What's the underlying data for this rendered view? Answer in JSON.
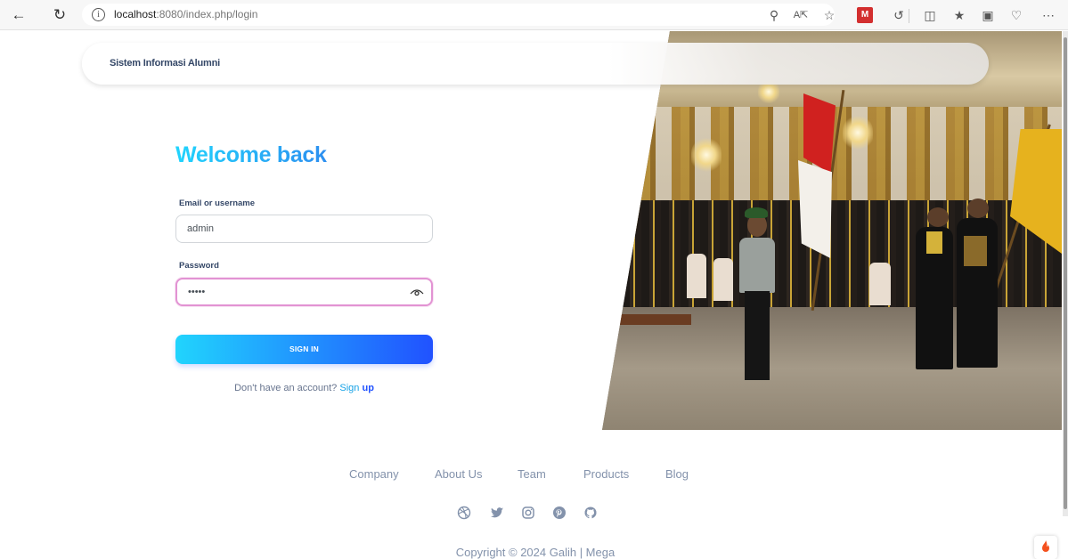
{
  "browser": {
    "url_host": "localhost",
    "url_rest": ":8080/index.php/login"
  },
  "navbar": {
    "brand": "Sistem Informasi Alumni"
  },
  "login": {
    "title": "Welcome back",
    "email_label": "Email or username",
    "email_value": "admin",
    "password_label": "Password",
    "password_value": "•••••",
    "signin_label": "SIGN IN",
    "signup_prompt": "Don't have an account?",
    "signup_link_prefix": "Sign",
    "signup_link_bold": "up"
  },
  "footer": {
    "links": [
      "Company",
      "About Us",
      "Team",
      "Products",
      "Blog"
    ],
    "social_icons": [
      "dribbble-icon",
      "twitter-icon",
      "instagram-icon",
      "pinterest-icon",
      "github-icon"
    ],
    "copyright": "Copyright © 2024 Galih | Mega"
  },
  "colors": {
    "accent_start": "#21d4fd",
    "accent_end": "#2152ff",
    "focus_border": "#e293d3",
    "text_dark": "#344767",
    "text_muted": "#8392ab"
  }
}
